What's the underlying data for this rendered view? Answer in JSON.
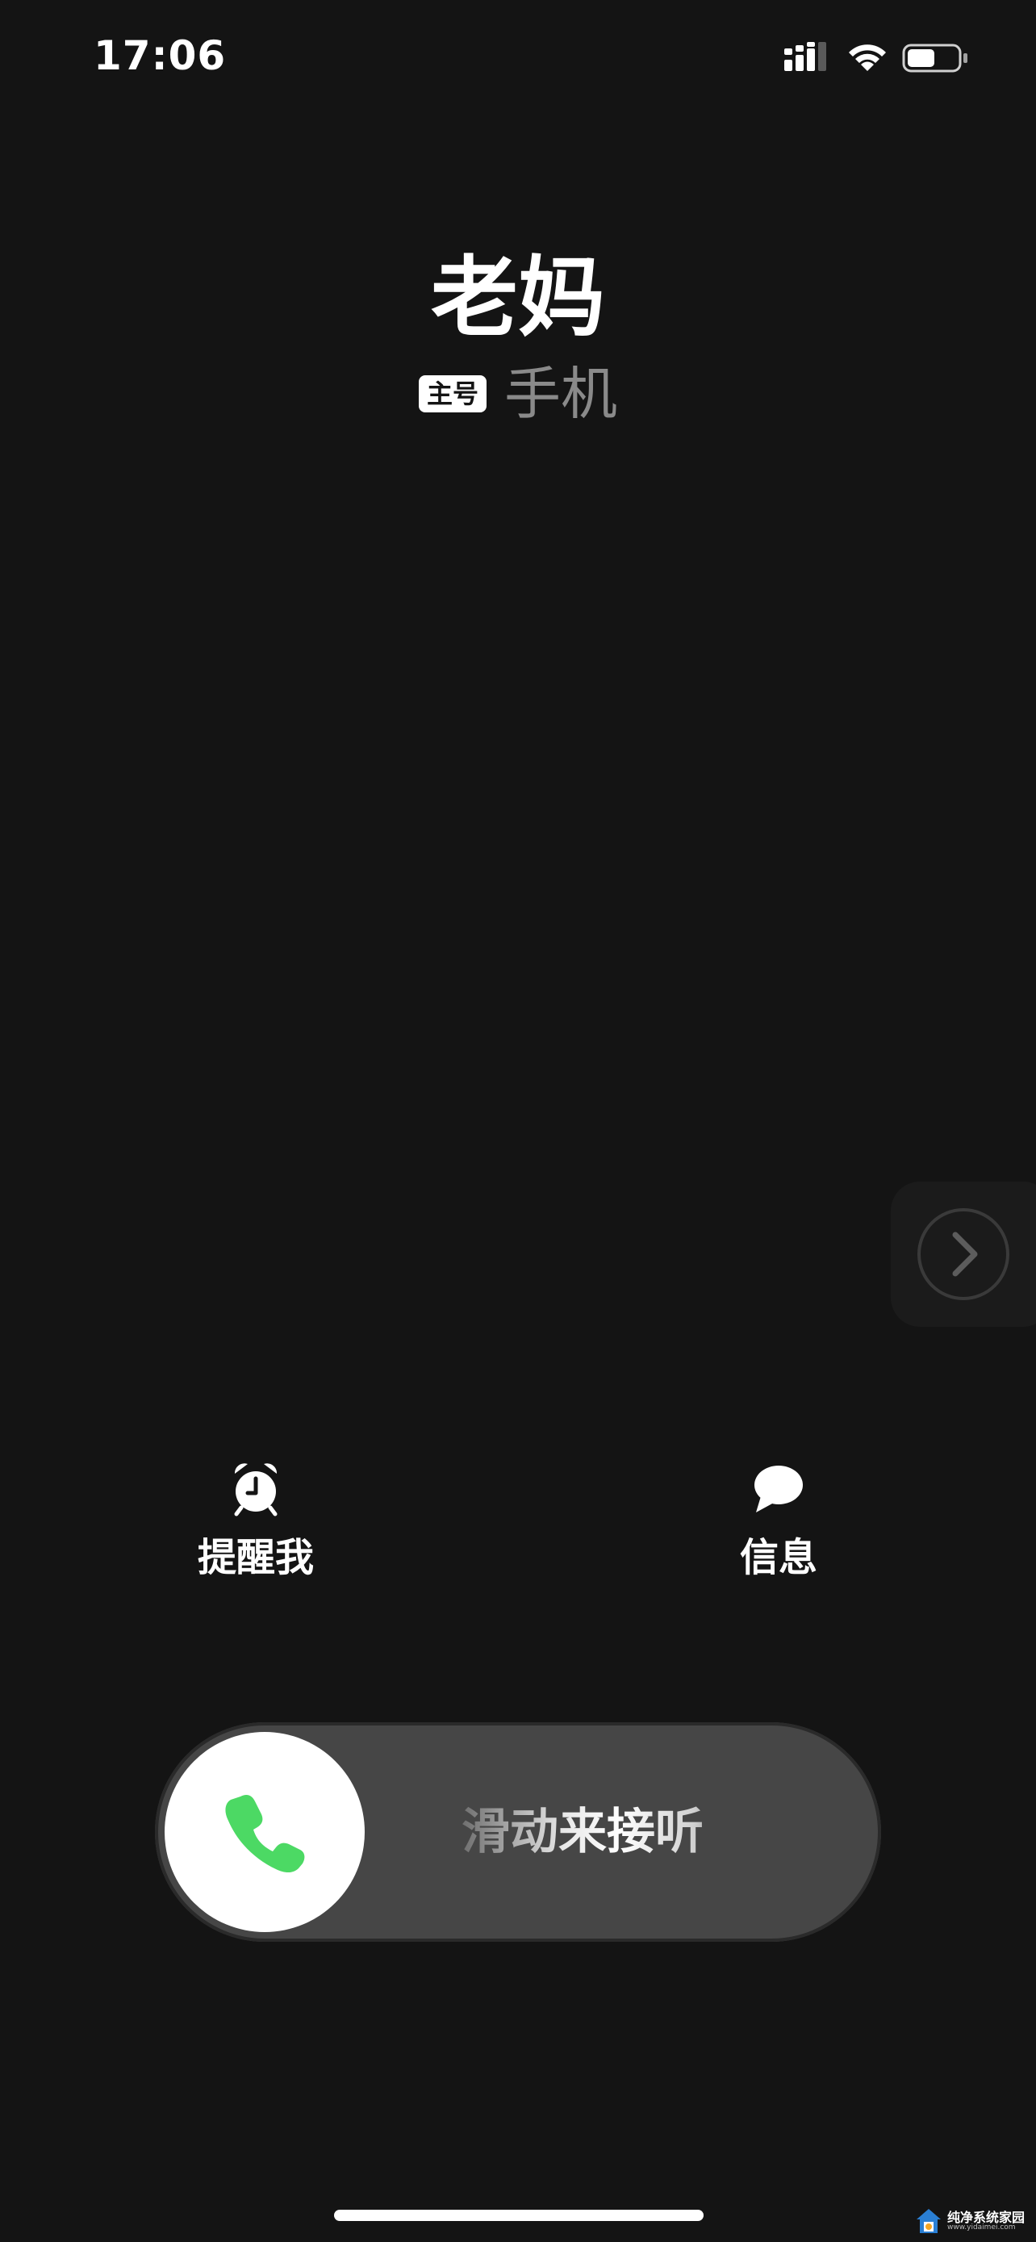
{
  "status_bar": {
    "time": "17:06",
    "icons": [
      "signal-icon",
      "wifi-icon",
      "battery-icon"
    ],
    "battery_level": 0.55
  },
  "caller": {
    "name": "老妈",
    "sim_badge": "主号",
    "phone_type": "手机"
  },
  "actions": {
    "remind": {
      "label": "提醒我",
      "icon": "alarm-clock-icon"
    },
    "message": {
      "label": "信息",
      "icon": "speech-bubble-icon"
    }
  },
  "slider": {
    "label": "滑动来接听",
    "icon": "phone-icon"
  },
  "side_panel": {
    "icon": "chevron-right-icon"
  },
  "watermark": {
    "title": "纯净系统家园",
    "url": "www.yidaimei.com"
  },
  "colors": {
    "background": "#141414",
    "slider_track": "#464646",
    "phone_green": "#4cd964",
    "secondary_text": "#8a8a8a"
  }
}
